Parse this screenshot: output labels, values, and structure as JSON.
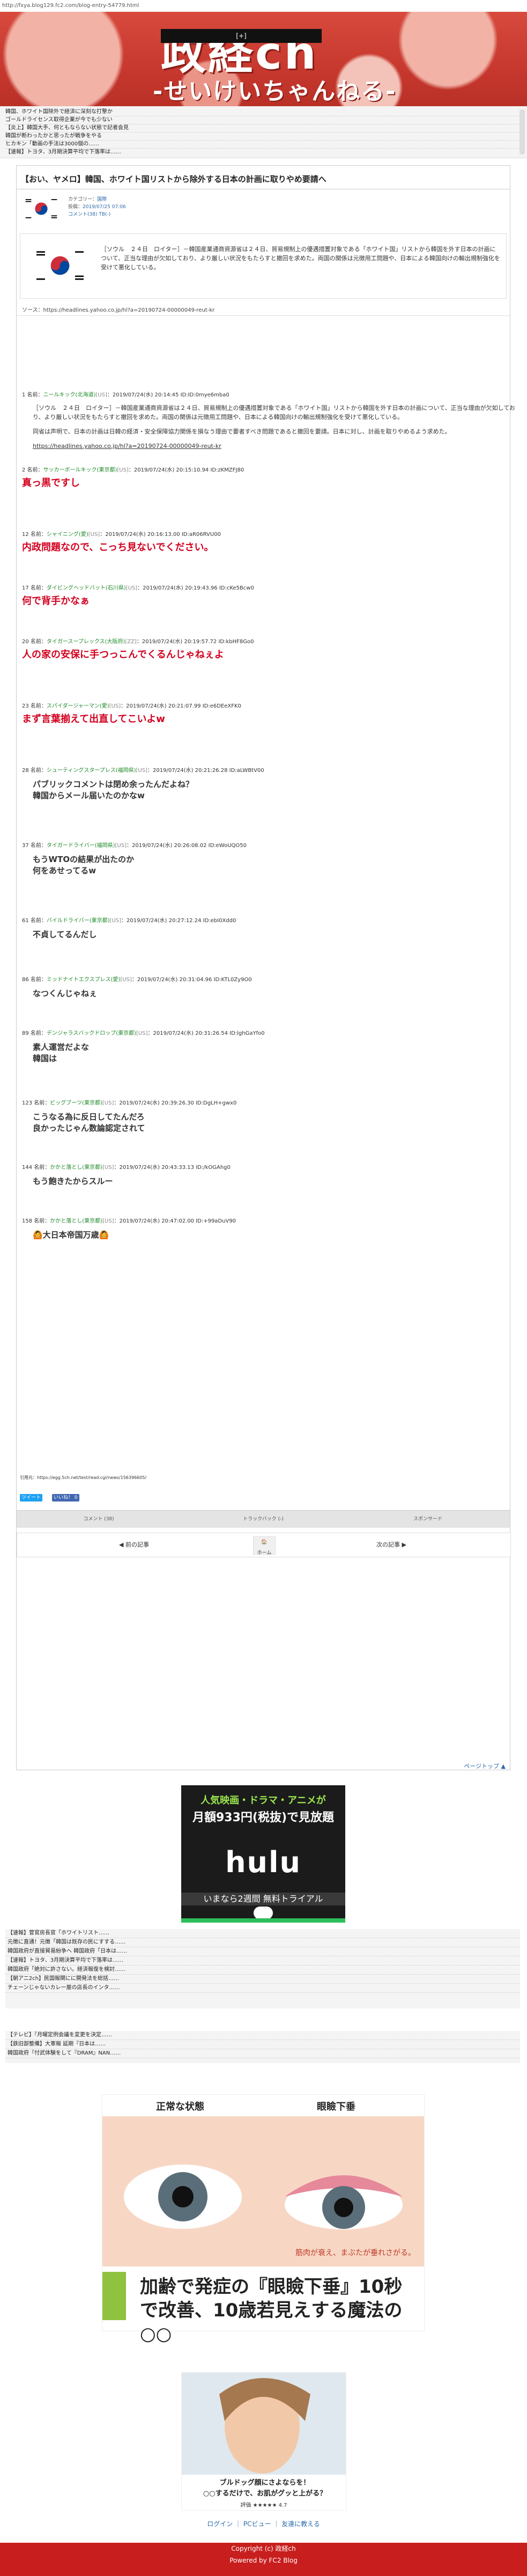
{
  "url": "http://fxya.blog129.fc2.com/blog-entry-54779.html",
  "header": {
    "title": "政経ch",
    "subtitle": "-せいけいちゃんねる-",
    "nav_label": "[+]"
  },
  "rss_top": [
    "韓国、ホワイト国除外で経済に深刻な打撃か",
    "ゴールドライセンス取得企業が今でも少ない",
    "【炎上】韓国大手、何ともならない状態で記者会見",
    "韓国が断わったかと思ったが戦争をやる",
    "ヒカキン「動画の手法は3000個の……",
    "【速報】トヨタ、3月期決算平均で下落率は……",
    "韓国政府「絶対に許さない。経済報復を検討して……"
  ],
  "post": {
    "title": "【おい、ヤメロ】韓国、ホワイト国リストから除外する日本の計画に取りやめ要請へ",
    "category_label": "カテゴリー：",
    "category": "国際",
    "date_label": "投稿：",
    "date": "2019/07/25 07:06",
    "comments_label": "コメント(38)",
    "tb_label": "TB(-)",
    "quote": "［ソウル　２４日　ロイター］－韓国産業通商資源省は２４日、貿易規制上の優遇措置対象である「ホワイト国」リストから韓国を外す日本の計画について、正当な理由が欠如しており、より厳しい状況をもたらすと撤回を求めた。両国の関係は元徴用工問題や、日本による韓国向けの輸出規制強化を受けて悪化している。",
    "source": "ソース：https://headlines.yahoo.co.jp/hl?a=20190724-00000049-reut-kr"
  },
  "responses": [
    {
      "num": "1",
      "name": "ニールキック(北海道)",
      "tag": "[US]",
      "date": "：2019/07/24(水) 20:14:45 ID:ID:0mye6mba0",
      "body": "［ソウル　２４日　ロイター］－韓国産業通商資源省は２４日、貿易規制上の優遇措置対象である「ホワイト国」リストから韓国を外す日本の計画について、正当な理由が欠如しており、より厳しい状況をもたらすと撤回を求めた。両国の関係は元徴用工問題や、日本による韓国向けの輸出規制強化を受けて悪化している。",
      "body2": "同省は声明で、日本の計画は日韓の経済・安全保障協力関係を損なう理由で要者すべき問題であると撤回を要請。日本に対し、計画を取りやめるよう求めた。",
      "link": "https://headlines.yahoo.co.jp/hl?a=20190724-00000049-reut-kr"
    },
    {
      "num": "2",
      "name": "サッカーボールキック(東京都)",
      "tag": "[US]",
      "date": "：2019/07/24(水) 20:15:10.94 ID:zKMZFJ80",
      "body": "真っ黒ですし"
    },
    {
      "num": "12",
      "name": "シャイニング(愛)",
      "tag": "[US]",
      "date": "：2019/07/24(水) 20:16:13.00 ID:aR06RVU00",
      "body": "内政問題なので、こっち見ないでください。"
    },
    {
      "num": "17",
      "name": "ダイビングヘッドバット(石川県)",
      "tag": "[US]",
      "date": "：2019/07/24(水) 20:19:43.96 ID:cKe5Bcw0",
      "body": "何で背手かなぁ"
    },
    {
      "num": "20",
      "name": "タイガースープレックス(大阪府)",
      "tag": "[ZZ]",
      "date": "：2019/07/24(水) 20:19:57.72 ID:kbHF8Go0",
      "body": "人の家の安保に手つっこんでくるんじゃねぇよ"
    },
    {
      "num": "23",
      "name": "スパイダージャーマン(愛)",
      "tag": "[US]",
      "date": "：2019/07/24(水) 20:21:07.99 ID:e6DEeXFK0",
      "body": "まず言葉揃えて出直してこいよw"
    },
    {
      "num": "28",
      "name": "シューティングスタープレス(福岡県)",
      "tag": "[US]",
      "date": "：2019/07/24(水) 20:21:26.28 ID:aLWBtV00",
      "body": "パブリックコメントは閉め余ったんだよね？\n韓国からメール届いたのかなw"
    },
    {
      "num": "37",
      "name": "タイガードライバー(福岡県)",
      "tag": "[US]",
      "date": "：2019/07/24(水) 20:26:08.02 ID:eWoUQO50",
      "body": "もうWTOの結果が出たのか\n何をあせってるw"
    },
    {
      "num": "61",
      "name": "バイルドライバー(東京都)",
      "tag": "[US]",
      "date": "：2019/07/24(水) 20:27:12.24 ID:ebI0Xdd0",
      "body": "不貞してるんだし"
    },
    {
      "num": "86",
      "name": "ミッドナイトエクスプレス(愛)",
      "tag": "[US]",
      "date": "：2019/07/24(水) 20:31:04.96 ID:KTL0Zy9O0",
      "body": "なつくんじゃねぇ"
    },
    {
      "num": "89",
      "name": "デンジャラスバックドロップ(東京都)",
      "tag": "[US]",
      "date": "：2019/07/24(水) 20:31:26.54 ID:lghGaYfo0",
      "body": "素人運営だよな\n韓国は"
    },
    {
      "num": "123",
      "name": "ビッグブーツ(東京都)",
      "tag": "[US]",
      "date": "：2019/07/24(水) 20:39:26.30 ID:DgLH+gwx0",
      "body": "こうなる為に反日してたんだろ\n良かったじゃん数論認定されて"
    },
    {
      "num": "144",
      "name": "かかと落とし(東京都)",
      "tag": "[US]",
      "date": "：2019/07/24(水) 20:43:33.13 ID:/kOGAhg0",
      "body": "もう飽きたからスルー"
    },
    {
      "num": "158",
      "name": "かかと落とし(東京都)",
      "tag": "[US]",
      "date": "：2019/07/24(水) 20:47:02.00 ID:+99aDuV90",
      "body": "🙆大日本帝国万歳🙆"
    }
  ],
  "source_footer": "引用元：https://egg.5ch.net/test/read.cgi/news/156396605/",
  "share": {
    "tweet": "ツイート",
    "like": "いいね！ 0"
  },
  "tabs": [
    "コメント\n(38)",
    "トラックバック\n(-)",
    "スポンサード"
  ],
  "pager": {
    "prev": "前の記事",
    "home": "ホーム",
    "next": "次の記事",
    "pagetop": "ページトップ ▲"
  },
  "hulu_ad": {
    "line1": "人気映画・ドラマ・アニメが",
    "line2": "月額933円(税抜)で見放題",
    "logo": "hulu",
    "line3": "いまなら2週間 無料トライアル"
  },
  "rss_mid": [
    "【速報】菅官房長官「ホワイトリスト……",
    "元徴に直通！元徴「韓国は既存の民にすする……",
    "韓国政府が直接貿易紛争へ 韓国政府「日本は……",
    "【速報】トヨタ、3月期決算平均で下落率は……",
    "韓国政府「絶対に許さない。経済報復を検討……",
    "【朝アニ2ch】民国報関にに開発法を総括……",
    "チェーンじゃないカレー屋の店長のインタ……"
  ],
  "rss_low": [
    "【テレビ】『月曜定例会議を変更を決定……",
    "【鉄旧部整備】大軍報 延期『日本は……",
    "韓国政府『付武体験をして『DRAM』NAN……"
  ],
  "eye_ad": {
    "label_left": "正常な状態",
    "label_right": "眼瞼下垂",
    "caption": "加齢で発症の『眼瞼下垂』10秒で改善、10歳若見えする魔法の○○",
    "note": "筋肉が衰え、まぶたが垂れさがる。"
  },
  "bulldog_ad": {
    "caption": "ブルドッグ顔にさよならを！\n○○するだけで、お肌がグッと上がる？",
    "rating": "評価 ★★★★★ 4.7"
  },
  "footer": {
    "links": "ログイン ｜ PCビュー ｜ 友達に教える",
    "copyright": "Copyright (c) 政経ch",
    "powered": "Powered by FC2 Blog"
  },
  "colors": {
    "brand_red": "#c81e1e",
    "name_green": "#208a2a",
    "highlight_red": "#d2001f",
    "link_blue": "#2a6aa8"
  }
}
